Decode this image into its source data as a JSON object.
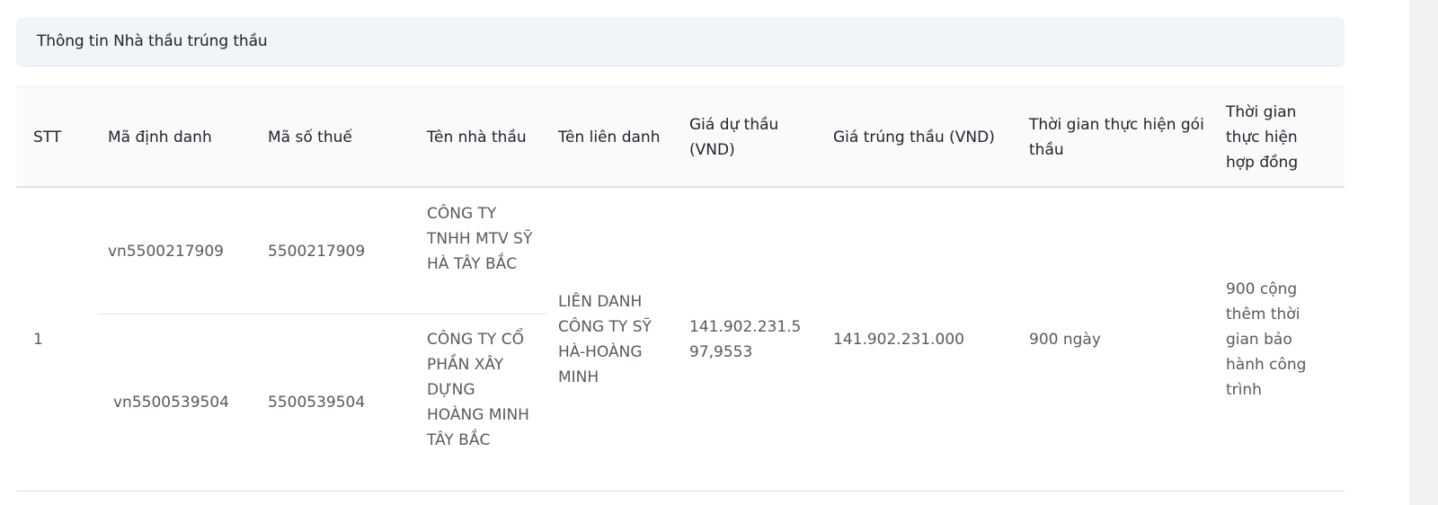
{
  "section": {
    "title": "Thông tin Nhà thầu trúng thầu"
  },
  "table": {
    "headers": {
      "stt": "STT",
      "ma_dinh_danh": "Mã định danh",
      "ma_so_thue": "Mã số thuế",
      "ten_nha_thau": "Tên nhà thầu",
      "ten_lien_danh": "Tên liên danh",
      "gia_du_thau": "Giá dự thầu (VND)",
      "gia_trung_thau": "Giá trúng thầu (VND)",
      "thoi_gian_goi_thau": "Thời gian thực hiện gói thầu",
      "thoi_gian_hop_dong": "Thời gian thực hiện hợp đồng"
    },
    "rows": [
      {
        "stt": "1",
        "contractors": [
          {
            "ma_dinh_danh": "vn5500217909",
            "ma_so_thue": "5500217909",
            "ten_nha_thau": "CÔNG TY TNHH MTV SỸ HÀ TÂY BẮC"
          },
          {
            "ma_dinh_danh": "vn5500539504",
            "ma_so_thue": "5500539504",
            "ten_nha_thau": "CÔNG TY CỔ PHẦN XÂY DỰNG HOÀNG MINH TÂY BẮC"
          }
        ],
        "ten_lien_danh": "LIÊN DANH CÔNG TY SỸ HÀ-HOÀNG MINH",
        "gia_du_thau": "141.902.231.597,9553",
        "gia_trung_thau": "141.902.231.000",
        "thoi_gian_goi_thau": "900 ngày",
        "thoi_gian_hop_dong": "900 cộng thêm thời gian bảo hành công trình"
      }
    ]
  }
}
